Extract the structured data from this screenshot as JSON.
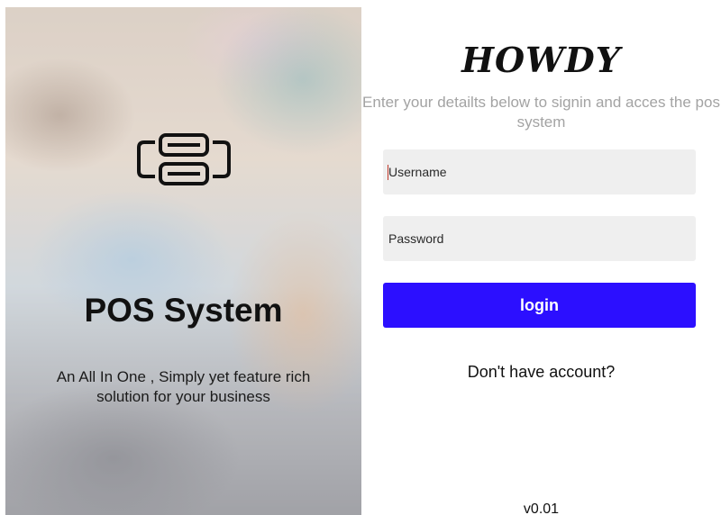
{
  "hero": {
    "icon": "pos-printer-icon",
    "title": "POS System",
    "tagline": "An All In One , Simply yet feature rich solution for your business"
  },
  "login": {
    "heading": "HOWDY",
    "subtitle": "Enter your detailts below to signin and acces the pos system",
    "username_placeholder": "Username",
    "password_placeholder": "Password",
    "submit_label": "login",
    "signup_link": "Don't have account?",
    "version": "v0.01"
  },
  "colors": {
    "primary": "#2c0fff",
    "input_bg": "#efefef",
    "subtitle_text": "#a3a3a3"
  }
}
